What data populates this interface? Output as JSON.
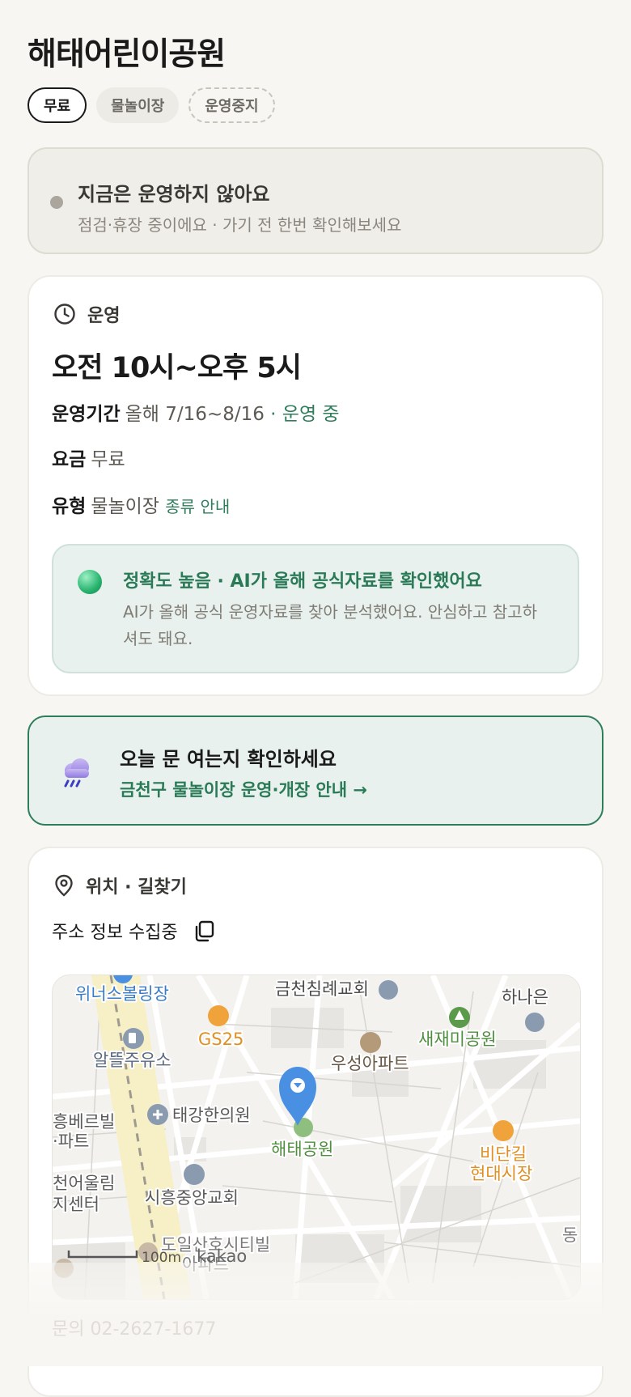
{
  "page": {
    "title": "해태어린이공원"
  },
  "chips": {
    "free": "무료",
    "type": "물놀이장",
    "stopped": "운영중지"
  },
  "status": {
    "title": "지금은 운영하지 않아요",
    "desc": "점검·휴장 중이에요 · 가기 전 한번 확인해보세요"
  },
  "operation": {
    "header": "운영",
    "hours": "오전 10시~오후 5시",
    "period_label": "운영기간",
    "period_value": "올해 7/16~8/16",
    "period_status": "· 운영 중",
    "fee_label": "요금",
    "fee_value": "무료",
    "type_label": "유형",
    "type_value": "물놀이장",
    "type_link": "종류 안내",
    "accuracy": {
      "title": "정확도 높음 · AI가 올해 공식자료를 확인했어요",
      "desc": "AI가 올해 공식 운영자료를 찾아 분석했어요. 안심하고 참고하셔도 돼요."
    }
  },
  "notice": {
    "title": "오늘 문 여는지 확인하세요",
    "link": "금천구 물놀이장 운영·개장 안내 →"
  },
  "location": {
    "header": "위치 · 길찾기",
    "address": "주소 정보 수집중",
    "map": {
      "labels": {
        "bowling": "위너스볼링장",
        "church1": "금천침례교회",
        "hana": "하나은",
        "gs25": "GS25",
        "saejaemi": "새재미공원",
        "gas": "알뜰주유소",
        "apt": "우성아파트",
        "hongbe1": "흥베르빌",
        "hongbe2": "·파트",
        "clinic": "태강한의원",
        "park": "해태공원",
        "market1": "비단길",
        "market2": "현대시장",
        "center1": "천어울림",
        "center2": "지센터",
        "church2": "시흥중앙교회",
        "city1": "도일산호시티빌",
        "city2": "아파트",
        "dong": "동",
        "scale": "100m",
        "brand": "kakao"
      }
    },
    "phone": "문의 02-2627-1677"
  },
  "colors": {
    "accent": "#2e7d5b",
    "pin": "#4a90e2",
    "park_green": "#5a9a4a"
  },
  "icons": [
    "clock-icon",
    "location-pin-icon",
    "copy-icon",
    "rain-cloud-icon",
    "map-pin-icon"
  ]
}
